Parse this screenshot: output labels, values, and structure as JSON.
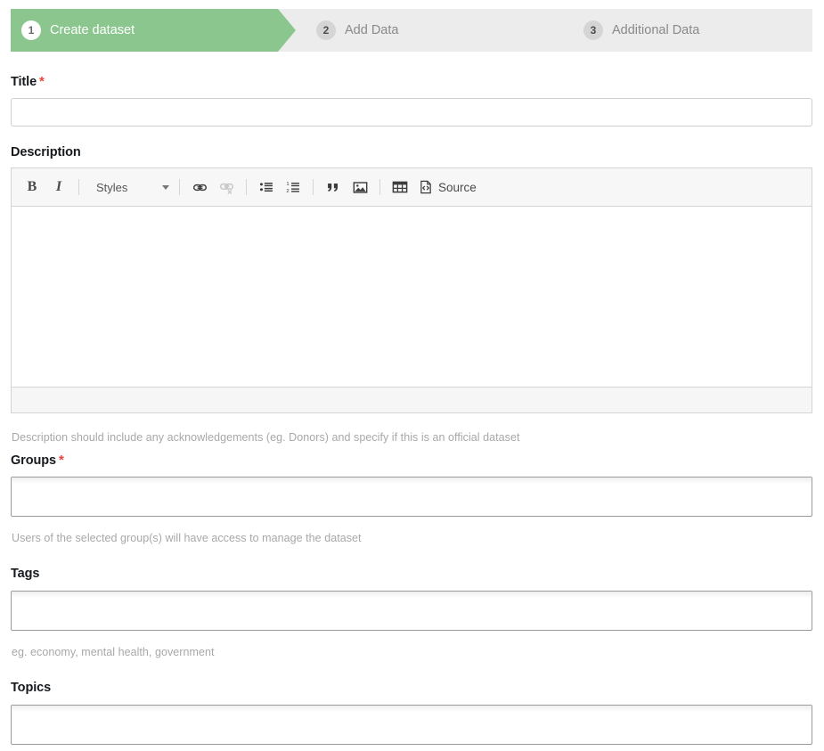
{
  "stepper": {
    "steps": [
      {
        "number": "1",
        "label": "Create dataset",
        "state": "active"
      },
      {
        "number": "2",
        "label": "Add Data",
        "state": "inactive"
      },
      {
        "number": "3",
        "label": "Additional Data",
        "state": "inactive"
      }
    ],
    "active_color": "#8cc68f",
    "track_color": "#ececec"
  },
  "colors": {
    "required_asterisk": "#e8443a",
    "hint_text": "#a8a8a8",
    "label_text": "#16191d"
  },
  "form": {
    "title": {
      "label": "Title",
      "required_marker": "*",
      "value": "",
      "placeholder": ""
    },
    "description": {
      "label": "Description",
      "value": "",
      "hint": "Description should include any acknowledgements (eg. Donors) and specify if this is an official dataset"
    },
    "groups": {
      "label": "Groups",
      "required_marker": "*",
      "value": "",
      "hint": "Users of the selected group(s) will have access to manage the dataset"
    },
    "tags": {
      "label": "Tags",
      "value": "",
      "hint": "eg. economy, mental health, government"
    },
    "topics": {
      "label": "Topics",
      "value": "",
      "hint": ""
    }
  },
  "editor_toolbar": {
    "bold_label": "B",
    "italic_label": "I",
    "styles_label": "Styles",
    "source_label": "Source",
    "buttons": [
      {
        "name": "bold",
        "label": "B",
        "enabled": true
      },
      {
        "name": "italic",
        "label": "I",
        "enabled": true
      },
      {
        "name": "styles",
        "label": "Styles",
        "enabled": true
      },
      {
        "name": "link",
        "label": "",
        "enabled": true
      },
      {
        "name": "unlink",
        "label": "",
        "enabled": false
      },
      {
        "name": "bulleted-list",
        "label": "",
        "enabled": true
      },
      {
        "name": "numbered-list",
        "label": "",
        "enabled": true
      },
      {
        "name": "blockquote",
        "label": "",
        "enabled": true
      },
      {
        "name": "image",
        "label": "",
        "enabled": true
      },
      {
        "name": "table",
        "label": "",
        "enabled": true
      },
      {
        "name": "source",
        "label": "Source",
        "enabled": true
      }
    ]
  }
}
